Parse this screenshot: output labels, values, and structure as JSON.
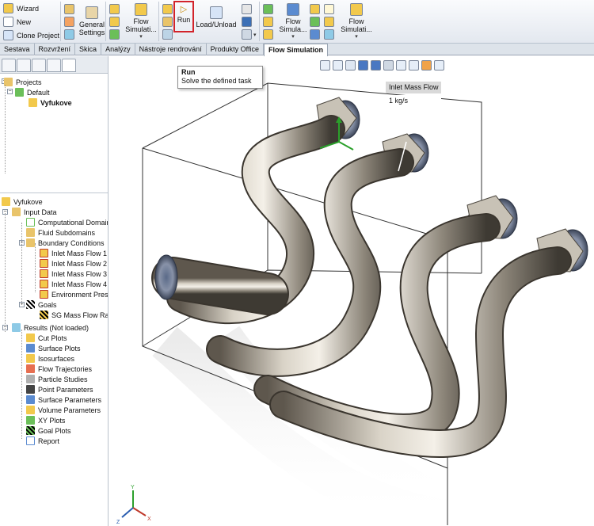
{
  "ribbon": {
    "wizard": "Wizard",
    "new": "New",
    "clone_project": "Clone Project",
    "general_settings": "General Settings",
    "flow_simulation_1": "Flow Simulati...",
    "run": "Run",
    "load_unload": "Load/Unload",
    "flow_simulation_2": "Flow Simula...",
    "flow_simulation_3": "Flow Simulati..."
  },
  "tabs": [
    "Sestava",
    "Rozvržení",
    "Skica",
    "Analýzy",
    "Nástroje rendrování",
    "Produkty Office",
    "Flow Simulation"
  ],
  "active_tab": "Flow Simulation",
  "tooltip": {
    "title": "Run",
    "description": "Solve the defined task"
  },
  "projects_tree": {
    "root": "Projects",
    "default": "Default",
    "project": "Vyfukove"
  },
  "analysis_tree": {
    "root": "Vyfukove",
    "input_data": "Input Data",
    "computational_domain": "Computational Domain",
    "fluid_subdomains": "Fluid Subdomains",
    "boundary_conditions": "Boundary Conditions",
    "inlets": [
      "Inlet Mass Flow 1",
      "Inlet Mass Flow 2",
      "Inlet Mass Flow 3",
      "Inlet Mass Flow 4"
    ],
    "environment_pressure": "Environment Pressure",
    "goals": "Goals",
    "sg_goal": "SG Mass Flow Rate",
    "results": "Results (Not loaded)",
    "result_items": [
      "Cut Plots",
      "Surface Plots",
      "Isosurfaces",
      "Flow Trajectories",
      "Particle Studies",
      "Point Parameters",
      "Surface Parameters",
      "Volume Parameters",
      "XY Plots",
      "Goal Plots",
      "Report"
    ]
  },
  "callout": {
    "label": "Inlet Mass Flow",
    "value": "1 kg/s"
  },
  "triad": {
    "x": "X",
    "y": "Y",
    "z": "Z"
  },
  "colors": {
    "highlight": "#d2232a",
    "pipe_metal": "#9a948a",
    "ribbon_bg": "#e9edf2"
  }
}
